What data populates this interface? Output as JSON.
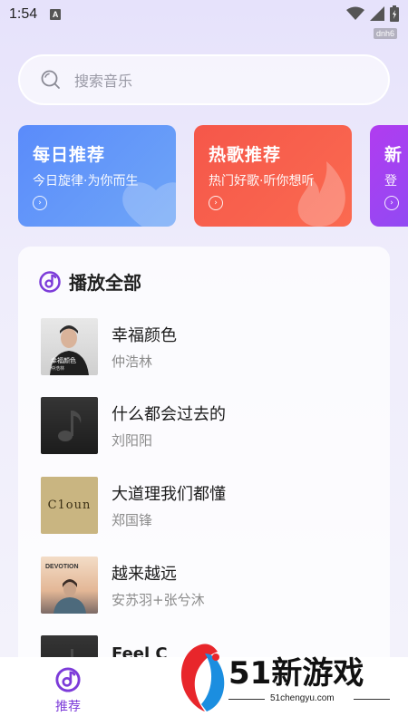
{
  "status": {
    "time": "1:54",
    "notif_letter": "A",
    "net_tag": "dnh6",
    "icons": [
      "wifi-icon",
      "signal-icon",
      "battery-icon"
    ]
  },
  "search": {
    "placeholder": "搜索音乐",
    "icon": "search-icon"
  },
  "cards": [
    {
      "title": "每日推荐",
      "subtitle": "今日旋律·为你而生",
      "color": "#5a8bfb",
      "icon": "heart-icon"
    },
    {
      "title": "热歌推荐",
      "subtitle": "热门好歌·听你想听",
      "color": "#f5574a",
      "icon": "flame-icon"
    },
    {
      "title": "新",
      "subtitle": "登",
      "color": "#b13cf0"
    }
  ],
  "playlist": {
    "title": "播放全部",
    "songs": [
      {
        "title": "幸福颜色",
        "artist": "仲浩林",
        "cover_text": "幸福颜色",
        "cover_sub": "仲浩林"
      },
      {
        "title": "什么都会过去的",
        "artist": "刘阳阳"
      },
      {
        "title": "大道理我们都懂",
        "artist": "郑国锋",
        "cover_text": "C1oun"
      },
      {
        "title": "越来越远",
        "artist": "安苏羽+张兮沐",
        "cover_text": "DEVOTION"
      },
      {
        "title": "Feel C",
        "artist": ""
      }
    ]
  },
  "bottom_nav": {
    "items": [
      {
        "label": "推荐",
        "active": true
      }
    ]
  },
  "watermark": {
    "brand": "51新游戏",
    "url": "51chengyu.com"
  },
  "colors": {
    "accent": "#7c3bd9"
  }
}
